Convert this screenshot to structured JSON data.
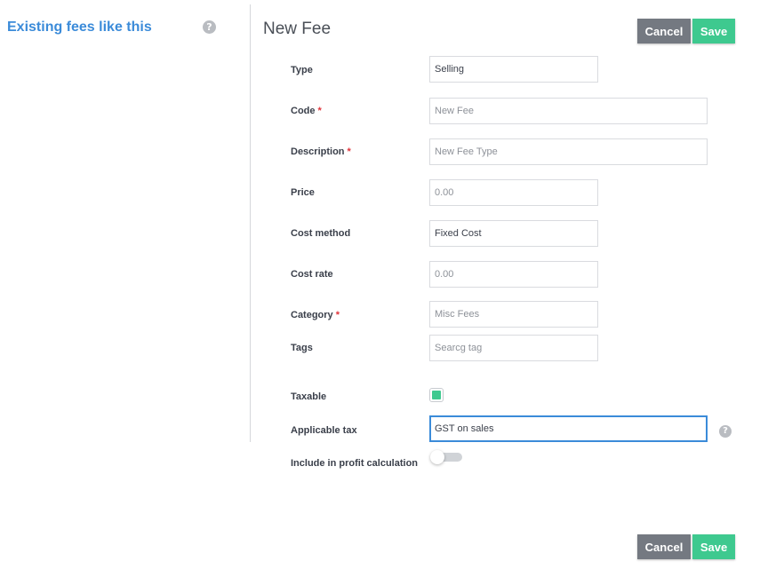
{
  "sidebar": {
    "title": "Existing fees like this",
    "help_icon": "?"
  },
  "header": {
    "title": "New Fee",
    "cancel_label": "Cancel",
    "save_label": "Save"
  },
  "footer": {
    "cancel_label": "Cancel",
    "save_label": "Save"
  },
  "form": {
    "type": {
      "label": "Type",
      "value": "Selling"
    },
    "code": {
      "label": "Code",
      "required_mark": "*",
      "placeholder": "New Fee"
    },
    "description": {
      "label": "Description",
      "required_mark": "*",
      "placeholder": "New Fee Type"
    },
    "price": {
      "label": "Price",
      "placeholder": "0.00"
    },
    "cost_method": {
      "label": "Cost method",
      "value": "Fixed Cost"
    },
    "cost_rate": {
      "label": "Cost rate",
      "placeholder": "0.00"
    },
    "category": {
      "label": "Category",
      "required_mark": "*",
      "placeholder": "Misc Fees"
    },
    "tags": {
      "label": "Tags",
      "placeholder": "Searcg tag"
    },
    "taxable": {
      "label": "Taxable",
      "checked": true
    },
    "applicable_tax": {
      "label": "Applicable tax",
      "value": "GST on sales",
      "help_icon": "?"
    },
    "include_profit": {
      "label": "Include in profit calculation",
      "enabled": false
    }
  },
  "colors": {
    "accent_blue": "#3b8bd9",
    "save_green": "#3ec98f",
    "cancel_gray": "#747981",
    "required_red": "#e0343b"
  },
  "icons": [
    "question-circle-icon",
    "checkbox-checked-icon",
    "toggle-switch-icon"
  ]
}
